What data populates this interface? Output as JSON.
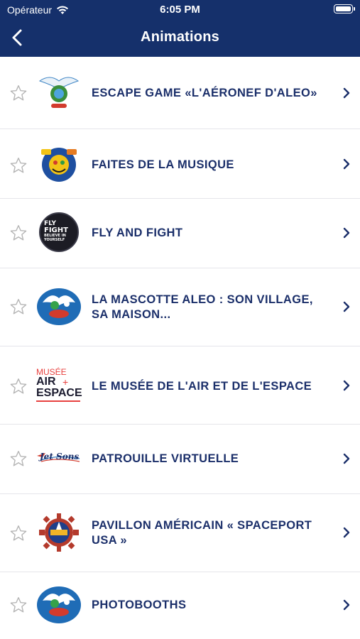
{
  "status_bar": {
    "carrier": "Opérateur",
    "time": "6:05 PM"
  },
  "nav": {
    "title": "Animations"
  },
  "colors": {
    "navbar": "#15306b",
    "text": "#1b2f6a",
    "star": "#b5b5b5"
  },
  "items": [
    {
      "label": "ESCAPE GAME «L'AÉRONEF D'ALEO»",
      "thumb": "aleo-bird-logo"
    },
    {
      "label": "FAITES DE LA MUSIQUE",
      "thumb": "music-cartoon-logo"
    },
    {
      "label": "FLY AND FIGHT",
      "thumb": "fly-and-fight-logo",
      "thumb_text": [
        "FLY",
        "FIGHT",
        "BELIEVE IN",
        "YOURSELF"
      ]
    },
    {
      "label": "LA MASCOTTE ALEO : SON VILLAGE, SA MAISON...",
      "thumb": "aleo-mascot-logo"
    },
    {
      "label": "LE MUSÉE DE L'AIR ET DE L'ESPACE",
      "thumb": "musee-air-espace-logo",
      "thumb_text": [
        "MUSÉE",
        "AIR",
        "ESPACE"
      ]
    },
    {
      "label": "PATROUILLE VIRTUELLE",
      "thumb": "jet-sons-logo",
      "thumb_text": [
        "Jet Sons"
      ]
    },
    {
      "label": "PAVILLON AMÉRICAIN « SPACEPORT USA »",
      "thumb": "spaceport-usa-logo"
    },
    {
      "label": "PHOTOBOOTHS",
      "thumb": "aleo-mascot-logo"
    }
  ]
}
